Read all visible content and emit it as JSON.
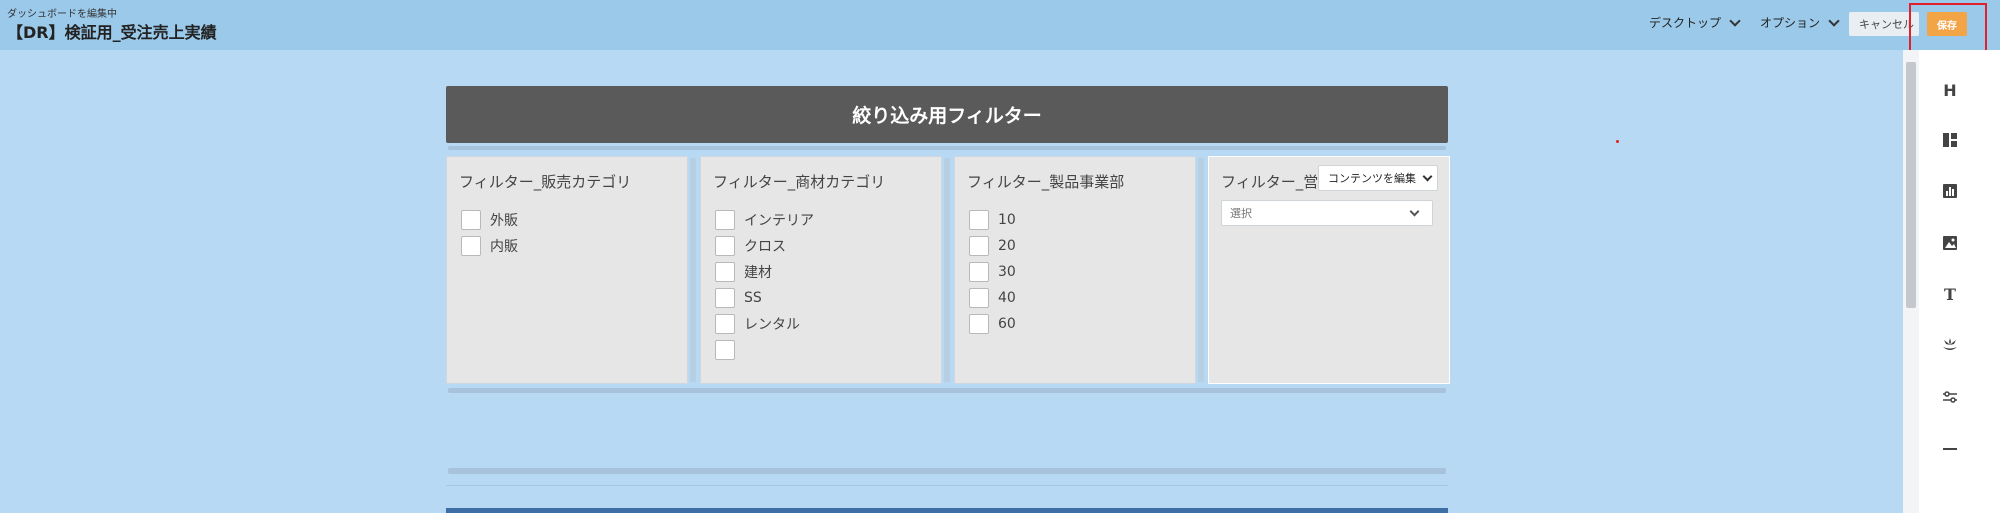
{
  "header": {
    "subtitle": "ダッシュボードを編集中",
    "title": "【DR】検証用_受注売上実績",
    "menu_desktop": "デスクトップ",
    "menu_options": "オプション",
    "cancel_label": "キャンセル",
    "save_label": "保存"
  },
  "toolbar": {
    "icons": [
      "header-icon",
      "layout-icon",
      "chart-icon",
      "image-icon",
      "text-icon",
      "filter-widget-icon",
      "sliders-icon",
      "divider-icon"
    ],
    "header_glyph": "H",
    "text_glyph": "T"
  },
  "canvas": {
    "banner_title": "絞り込み用フィルター",
    "filters": [
      {
        "title": "フィルター_販売カテゴリ",
        "options": [
          "外販",
          "内販"
        ]
      },
      {
        "title": "フィルター_商材カテゴリ",
        "options": [
          "インテリア",
          "クロス",
          "建材",
          "SS",
          "レンタル",
          ""
        ]
      },
      {
        "title": "フィルター_製品事業部",
        "options": [
          "10",
          "20",
          "30",
          "40",
          "60"
        ]
      },
      {
        "title": "フィルター_営業",
        "options": []
      }
    ],
    "edit_content_label": "コンテンツを編集",
    "select_placeholder": "選択"
  },
  "colors": {
    "background": "#b8d9f3",
    "header": "#9bc9ea",
    "banner": "#5a5a5a",
    "save_button": "#f3a446",
    "highlight": "#e0202a"
  }
}
